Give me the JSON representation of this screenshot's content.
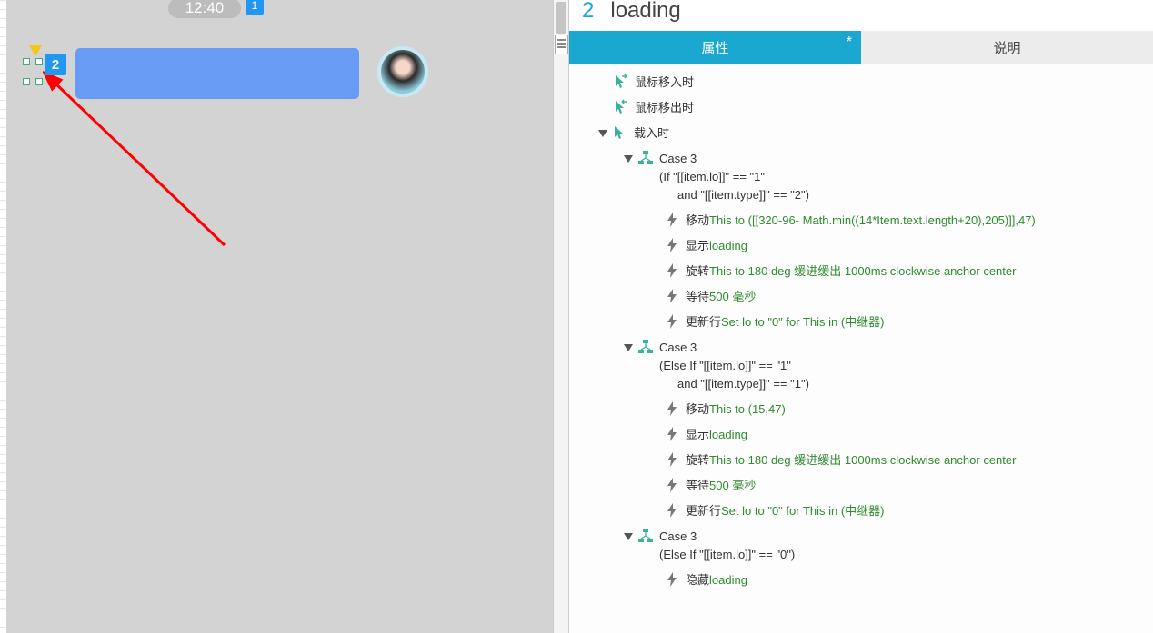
{
  "canvas": {
    "timestamp": "12:40",
    "badge1": "1",
    "badge2": "2"
  },
  "header": {
    "number": "2",
    "title": "loading"
  },
  "tabs": {
    "active": "属性",
    "dirty": "*",
    "inactive": "说明"
  },
  "events": {
    "mouseIn": "鼠标移入时",
    "mouseOut": "鼠标移出时",
    "onLoad": "载入时"
  },
  "cases": [
    {
      "name": "Case 3",
      "cond1": "(If \"[[item.lo]]\" == \"1\"",
      "cond2": "and \"[[item.type]]\" == \"2\")",
      "actions": [
        {
          "label": "移动 ",
          "detail": "This to ([[320-96- Math.min((14*Item.text.length+20),205)]],47)"
        },
        {
          "label": "显示 ",
          "detail": "loading"
        },
        {
          "label": "旋转",
          "detail": "This to 180 deg 缓进缓出 1000ms clockwise anchor center"
        },
        {
          "label": "等待 ",
          "detail": "500 毫秒"
        },
        {
          "label": "更新行 ",
          "detail": "Set lo to \"0\" for This in (中继器)"
        }
      ]
    },
    {
      "name": "Case 3",
      "cond1": "(Else If \"[[item.lo]]\" == \"1\"",
      "cond2": "and \"[[item.type]]\" == \"1\")",
      "actions": [
        {
          "label": "移动 ",
          "detail": "This to (15,47)"
        },
        {
          "label": "显示 ",
          "detail": "loading"
        },
        {
          "label": "旋转",
          "detail": "This to 180 deg 缓进缓出 1000ms clockwise anchor center"
        },
        {
          "label": "等待 ",
          "detail": "500 毫秒"
        },
        {
          "label": "更新行 ",
          "detail": "Set lo to \"0\" for This in (中继器)"
        }
      ]
    },
    {
      "name": "Case 3",
      "cond1": "(Else If \"[[item.lo]]\" == \"0\")",
      "cond2": "",
      "actions": [
        {
          "label": "隐藏 ",
          "detail": "loading"
        }
      ]
    }
  ]
}
